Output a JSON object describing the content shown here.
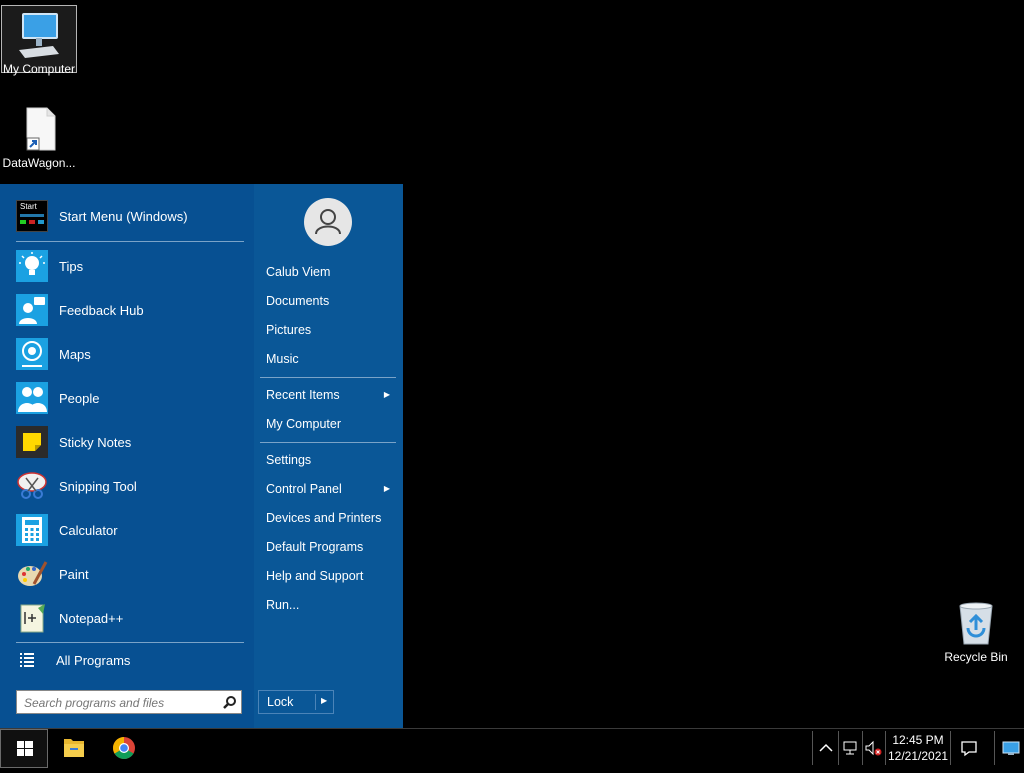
{
  "desktop": {
    "icons": [
      {
        "label": "My Computer",
        "icon": "computer-icon"
      },
      {
        "label": "DataWagon...",
        "icon": "shortcut-file-icon"
      },
      {
        "label": "Recycle Bin",
        "icon": "recycle-bin-icon"
      }
    ]
  },
  "start_menu": {
    "header_item": {
      "label": "Start Menu (Windows)",
      "icon": "start-menu-app-icon"
    },
    "pinned": [
      {
        "label": "Tips",
        "icon": "lightbulb-icon"
      },
      {
        "label": "Feedback Hub",
        "icon": "feedback-hub-icon"
      },
      {
        "label": "Maps",
        "icon": "maps-icon"
      },
      {
        "label": "People",
        "icon": "people-icon"
      },
      {
        "label": "Sticky Notes",
        "icon": "sticky-notes-icon"
      },
      {
        "label": "Snipping Tool",
        "icon": "scissors-icon"
      },
      {
        "label": "Calculator",
        "icon": "calculator-icon"
      },
      {
        "label": "Paint",
        "icon": "paint-palette-icon"
      },
      {
        "label": "Notepad++",
        "icon": "notepad-plus-icon"
      }
    ],
    "all_programs": "All Programs",
    "search": {
      "placeholder": "Search programs and files",
      "value": ""
    },
    "user_name": "Calub Viem",
    "right_items_1": [
      "Documents",
      "Pictures",
      "Music"
    ],
    "right_items_2": [
      {
        "label": "Recent Items",
        "submenu": true
      },
      {
        "label": "My Computer",
        "submenu": false
      }
    ],
    "right_items_3": [
      {
        "label": "Settings",
        "submenu": false
      },
      {
        "label": "Control Panel",
        "submenu": true
      },
      {
        "label": "Devices and Printers",
        "submenu": false
      },
      {
        "label": "Default Programs",
        "submenu": false
      },
      {
        "label": "Help and Support",
        "submenu": false
      },
      {
        "label": "Run...",
        "submenu": false
      }
    ],
    "lock_label": "Lock",
    "colors": {
      "left_pane": "#075092",
      "right_pane": "#0a5797",
      "accent_tile": "#1ba1e2"
    }
  },
  "taskbar": {
    "apps": [
      {
        "name": "start",
        "icon": "windows-logo-icon"
      },
      {
        "name": "file-explorer",
        "icon": "folder-icon"
      },
      {
        "name": "chrome",
        "icon": "chrome-icon"
      }
    ],
    "clock": {
      "time": "12:45 PM",
      "date": "12/21/2021"
    },
    "tray_icons": [
      "chevron-up-icon",
      "network-icon",
      "volume-muted-icon",
      "action-center-icon",
      "show-desktop-icon"
    ]
  }
}
